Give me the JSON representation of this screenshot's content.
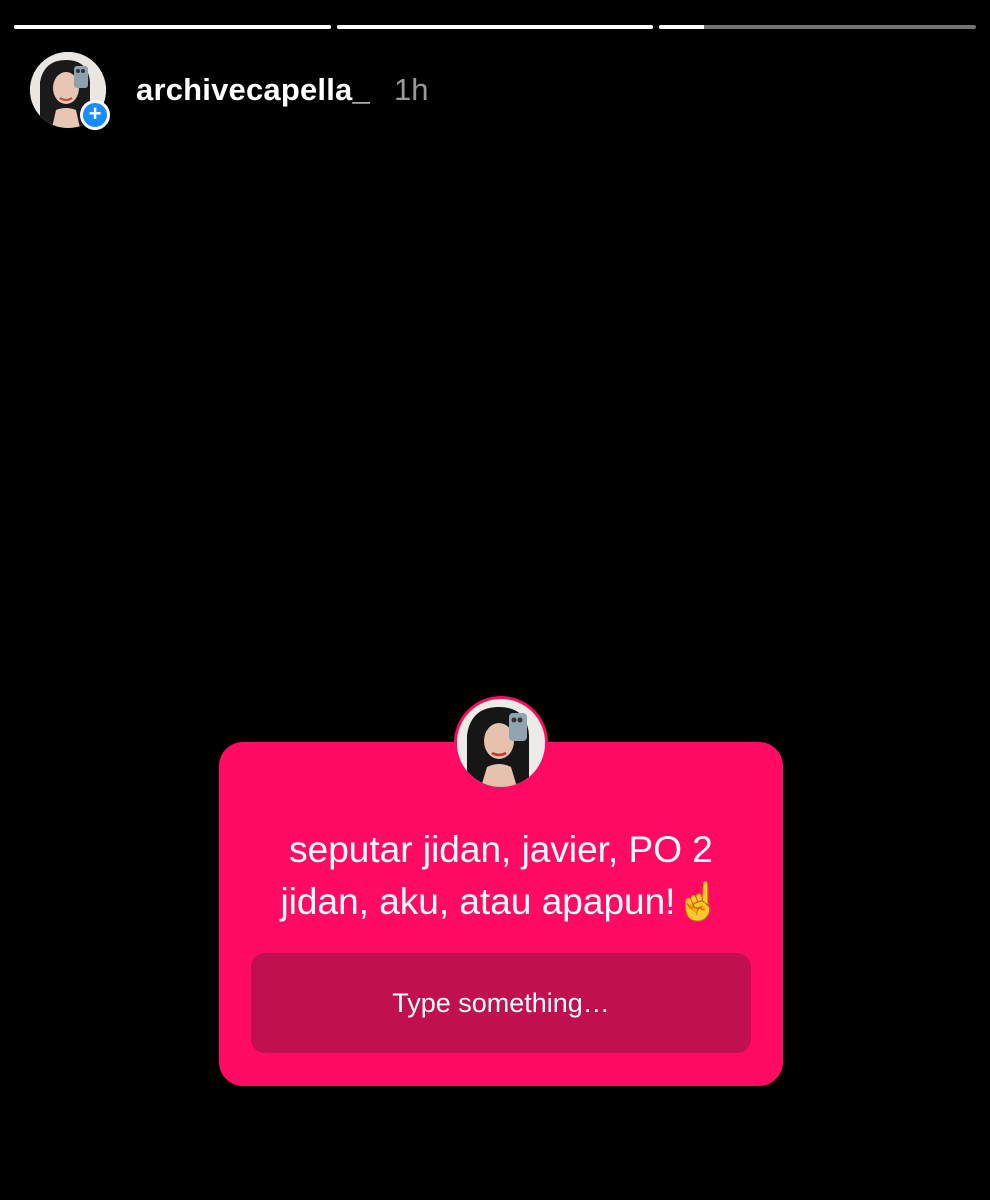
{
  "story": {
    "progress": [
      1.0,
      1.0,
      0.14
    ],
    "username": "archivecapella_",
    "time": "1h",
    "add_icon": "plus-icon"
  },
  "sticker": {
    "question_line1": "seputar jidan, javier, PO 2",
    "question_line2": "jidan, aku, atau apapun!☝️",
    "placeholder": "Type something…",
    "color": "#ff0b63",
    "input_color": "#c0104f"
  }
}
